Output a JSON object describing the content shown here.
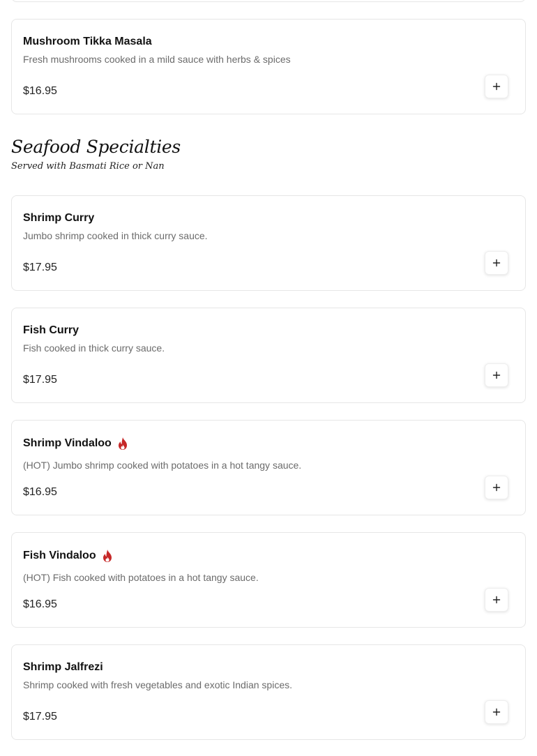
{
  "previous_section": {
    "items": [
      {
        "name": "Mushroom Tikka Masala",
        "description": "Fresh mushrooms cooked in a mild sauce with herbs & spices",
        "price": "$16.95",
        "spicy": false
      }
    ]
  },
  "section": {
    "title": "Seafood Specialties",
    "subtitle": "Served with Basmati Rice or Nan",
    "items": [
      {
        "name": "Shrimp Curry",
        "description": "Jumbo shrimp cooked in thick curry sauce.",
        "price": "$17.95",
        "spicy": false
      },
      {
        "name": "Fish Curry",
        "description": "Fish cooked in thick curry sauce.",
        "price": "$17.95",
        "spicy": false
      },
      {
        "name": "Shrimp Vindaloo",
        "description": "(HOT) Jumbo shrimp cooked with potatoes in a hot tangy sauce.",
        "price": "$16.95",
        "spicy": true
      },
      {
        "name": "Fish Vindaloo",
        "description": "(HOT) Fish cooked with potatoes in a hot tangy sauce.",
        "price": "$16.95",
        "spicy": true
      },
      {
        "name": "Shrimp Jalfrezi",
        "description": "Shrimp cooked with fresh vegetables and exotic Indian spices.",
        "price": "$17.95",
        "spicy": false
      }
    ]
  },
  "icons": {
    "add": "plus-icon",
    "spicy": "fire-icon"
  },
  "colors": {
    "spicy": "#c62828",
    "card_border": "#e6e6e6",
    "description": "#6b6b6b"
  }
}
